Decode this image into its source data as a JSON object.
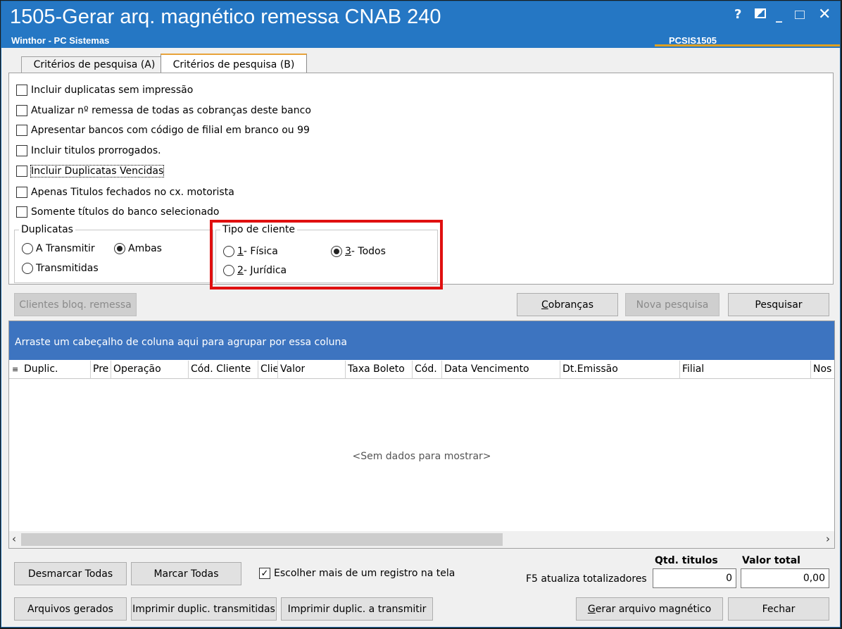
{
  "window": {
    "title": "1505-Gerar arq. magnético remessa CNAB 240",
    "subtitle": "Winthor - PC Sistemas",
    "program_code": "PCSIS1505",
    "controls": {
      "help": "?",
      "minimize": "_",
      "close": "✕"
    }
  },
  "tabs": [
    {
      "label": "Critérios de pesquisa (A)",
      "active": false
    },
    {
      "label": "Critérios de pesquisa (B)",
      "active": true
    }
  ],
  "checkboxes": [
    {
      "label": "Incluir duplicatas sem impressão",
      "checked": false
    },
    {
      "label": "Atualizar nº remessa de todas as cobranças deste banco",
      "checked": false
    },
    {
      "label": "Apresentar bancos com código de filial em branco ou 99",
      "checked": false
    },
    {
      "label": "Incluir titulos prorrogados.",
      "checked": false
    },
    {
      "label": "Incluir Duplicatas Vencidas",
      "checked": false
    },
    {
      "label": "Apenas Titulos fechados no cx. motorista",
      "checked": false
    },
    {
      "label": "Somente títulos do banco selecionado",
      "checked": false
    }
  ],
  "duplicatas": {
    "title": "Duplicatas",
    "options": [
      {
        "label": "A Transmitir",
        "selected": false
      },
      {
        "label": "Ambas",
        "selected": true
      },
      {
        "label": "Transmitidas",
        "selected": false
      }
    ]
  },
  "tipo_cliente": {
    "title": "Tipo de cliente",
    "options": [
      {
        "key": "1",
        "label": " - Física",
        "selected": false
      },
      {
        "key": "3",
        "label": " - Todos",
        "selected": true
      },
      {
        "key": "2",
        "label": " - Jurídica",
        "selected": false
      }
    ]
  },
  "buttons": {
    "clientes_bloq": "Clientes bloq. remessa",
    "cobrancas_key": "C",
    "cobrancas_rest": "obranças",
    "nova_pesquisa": "Nova pesquisa",
    "pesquisar": "Pesquisar",
    "desmarcar": "Desmarcar Todas",
    "marcar": "Marcar Todas",
    "arquivos": "Arquivos gerados",
    "imprimir_transmitidas": "Imprimir duplic. transmitidas",
    "imprimir_a_transmitir": "Imprimir duplic. a transmitir",
    "gerar_key": "G",
    "gerar_rest": "erar arquivo magnético",
    "fechar": "Fechar"
  },
  "grid": {
    "group_hint": "Arraste um cabeçalho de coluna aqui para agrupar por essa coluna",
    "columns": [
      "Duplic.",
      "Pre",
      "Operação",
      "Cód. Cliente",
      "Clie",
      "Valor",
      "Taxa Boleto",
      "Cód.",
      "Data Vencimento",
      "Dt.Emissão",
      "Filial",
      "Nos"
    ],
    "empty_text": "<Sem dados para mostrar>"
  },
  "footer": {
    "escolher_label": "Escolher mais de um registro na tela",
    "escolher_checked": true,
    "f5_label": "F5 atualiza totalizadores",
    "qtd_label": "Qtd. titulos",
    "qtd_value": "0",
    "valor_label": "Valor total",
    "valor_value": "0,00"
  },
  "colors": {
    "titlebar": "#2577c4",
    "group_panel": "#3d74c0",
    "highlight_box": "#e01010",
    "tab_accent": "#e8a33a"
  }
}
